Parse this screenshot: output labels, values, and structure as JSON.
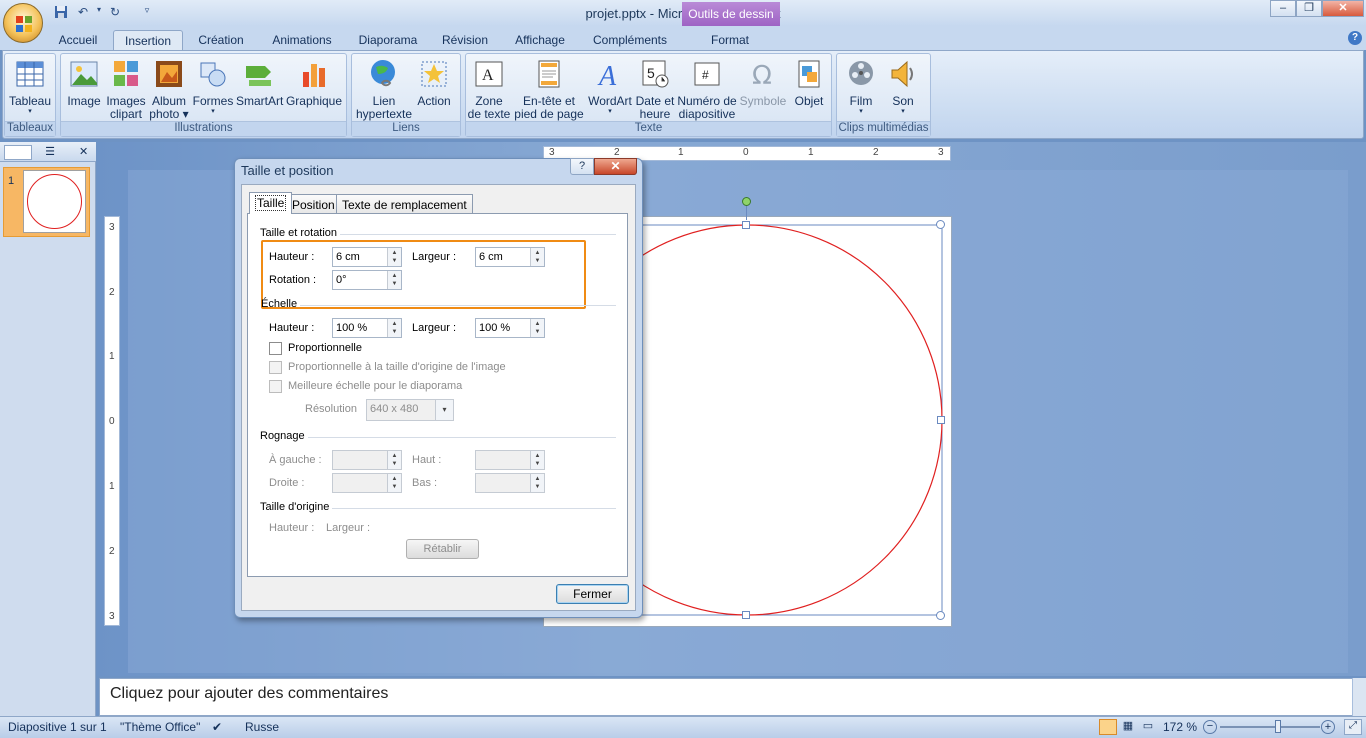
{
  "window": {
    "title": "projet.pptx - Microsoft PowerPoint",
    "contextual_tab": "Outils de dessin",
    "minimize": "‒",
    "restore": "❐",
    "close": "✕"
  },
  "tabs": [
    "Accueil",
    "Insertion",
    "Création",
    "Animations",
    "Diaporama",
    "Révision",
    "Affichage",
    "Compléments",
    "Format"
  ],
  "active_tab": "Insertion",
  "ribbon": {
    "groups": {
      "tableaux": "Tableaux",
      "illustrations": "Illustrations",
      "liens": "Liens",
      "texte": "Texte",
      "clips": "Clips multimédias"
    },
    "buttons": {
      "tableau": "Tableau",
      "image": "Image",
      "images_clipart_1": "Images",
      "images_clipart_2": "clipart",
      "album_1": "Album",
      "album_2": "photo",
      "formes": "Formes",
      "smartart": "SmartArt",
      "graphique": "Graphique",
      "lien_1": "Lien",
      "lien_2": "hypertexte",
      "action": "Action",
      "zone_1": "Zone",
      "zone_2": "de texte",
      "entete_1": "En-tête et",
      "entete_2": "pied de page",
      "wordart": "WordArt",
      "date_1": "Date et",
      "date_2": "heure",
      "numero_1": "Numéro de",
      "numero_2": "diapositive",
      "symbole": "Symbole",
      "objet": "Objet",
      "film": "Film",
      "son": "Son"
    }
  },
  "rulers": {
    "h_labels": [
      "3",
      "2",
      "1",
      "0",
      "1",
      "2",
      "3"
    ],
    "v_labels": [
      "3",
      "2",
      "1",
      "0",
      "1",
      "2",
      "3"
    ]
  },
  "thumbnail": {
    "number": "1"
  },
  "notes": {
    "placeholder": "Cliquez pour ajouter des commentaires"
  },
  "status": {
    "slide": "Diapositive 1 sur 1",
    "theme": "\"Thème Office\"",
    "language": "Russe",
    "zoom": "172 %"
  },
  "dialog": {
    "title": "Taille et position",
    "help": "?",
    "close": "✕",
    "tabs": [
      "Taille",
      "Position",
      "Texte de remplacement"
    ],
    "size_rotation": {
      "section": "Taille et rotation",
      "height_label": "Hauteur :",
      "height_value": "6 cm",
      "width_label": "Largeur :",
      "width_value": "6 cm",
      "rotation_label": "Rotation :",
      "rotation_value": "0°"
    },
    "scale": {
      "section": "Échelle",
      "height_label": "Hauteur :",
      "height_value": "100 %",
      "width_label": "Largeur :",
      "width_value": "100 %",
      "proportional": "Proportionnelle",
      "proportional_original": "Proportionnelle à la taille d'origine de l'image",
      "best_scale": "Meilleure échelle pour le diaporama",
      "resolution_label": "Résolution",
      "resolution_value": "640 x 480"
    },
    "crop": {
      "section": "Rognage",
      "left": "À gauche :",
      "top": "Haut :",
      "right": "Droite :",
      "bottom": "Bas :"
    },
    "original": {
      "section": "Taille d'origine",
      "height": "Hauteur :",
      "width": "Largeur :",
      "reset": "Rétablir"
    },
    "close_button": "Fermer"
  },
  "colors": {
    "circle_stroke": "#e02020",
    "highlight": "#f08b14"
  }
}
